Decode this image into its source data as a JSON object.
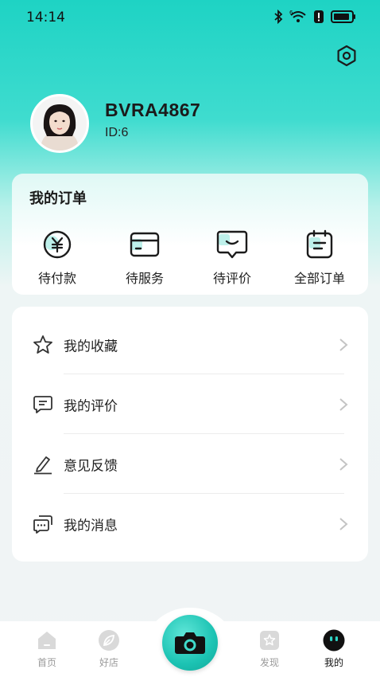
{
  "status_bar": {
    "time": "14:14"
  },
  "profile": {
    "username": "BVRA4867",
    "user_id": "ID:6"
  },
  "orders": {
    "title": "我的订单",
    "items": [
      {
        "label": "待付款",
        "icon": "yen-circle-icon"
      },
      {
        "label": "待服务",
        "icon": "card-icon"
      },
      {
        "label": "待评价",
        "icon": "comment-icon"
      },
      {
        "label": "全部订单",
        "icon": "clipboard-icon"
      }
    ]
  },
  "menu": {
    "items": [
      {
        "label": "我的收藏",
        "icon": "star-icon"
      },
      {
        "label": "我的评价",
        "icon": "comment-icon"
      },
      {
        "label": "意见反馈",
        "icon": "pencil-icon"
      },
      {
        "label": "我的消息",
        "icon": "chat-bubbles-icon"
      }
    ]
  },
  "bottom_nav": {
    "items": [
      {
        "label": "首页",
        "icon": "home-icon"
      },
      {
        "label": "好店",
        "icon": "leaf-icon"
      },
      {
        "label": "发现",
        "icon": "discover-icon"
      },
      {
        "label": "我的",
        "icon": "profile-icon",
        "active": true
      }
    ],
    "center_icon": "camera-icon"
  },
  "colors": {
    "accent": "#1ed3c4",
    "text": "#222222",
    "muted": "#9a9a9a"
  }
}
